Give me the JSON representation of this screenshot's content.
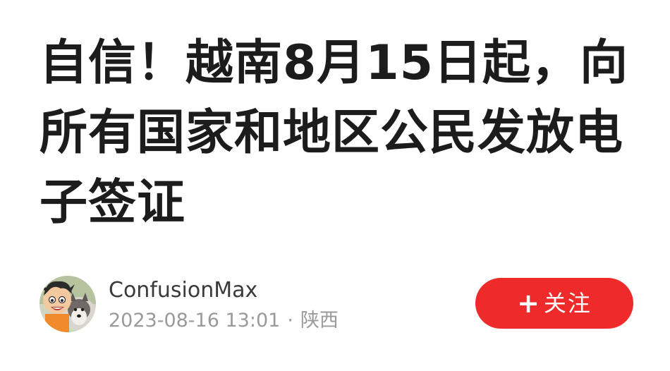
{
  "article": {
    "title": "自信！越南8月15日起，向所有国家和地区公民发放电子签证"
  },
  "author": {
    "name": "ConfusionMax",
    "date": "2023-08-16 13:01",
    "separator": "·",
    "location": "陕西",
    "avatar_icon": "avatar-cartoon-and-dog-icon"
  },
  "follow": {
    "icon": "plus-icon",
    "icon_glyph": "+",
    "label": "关注",
    "color": "#ee2a2a"
  }
}
